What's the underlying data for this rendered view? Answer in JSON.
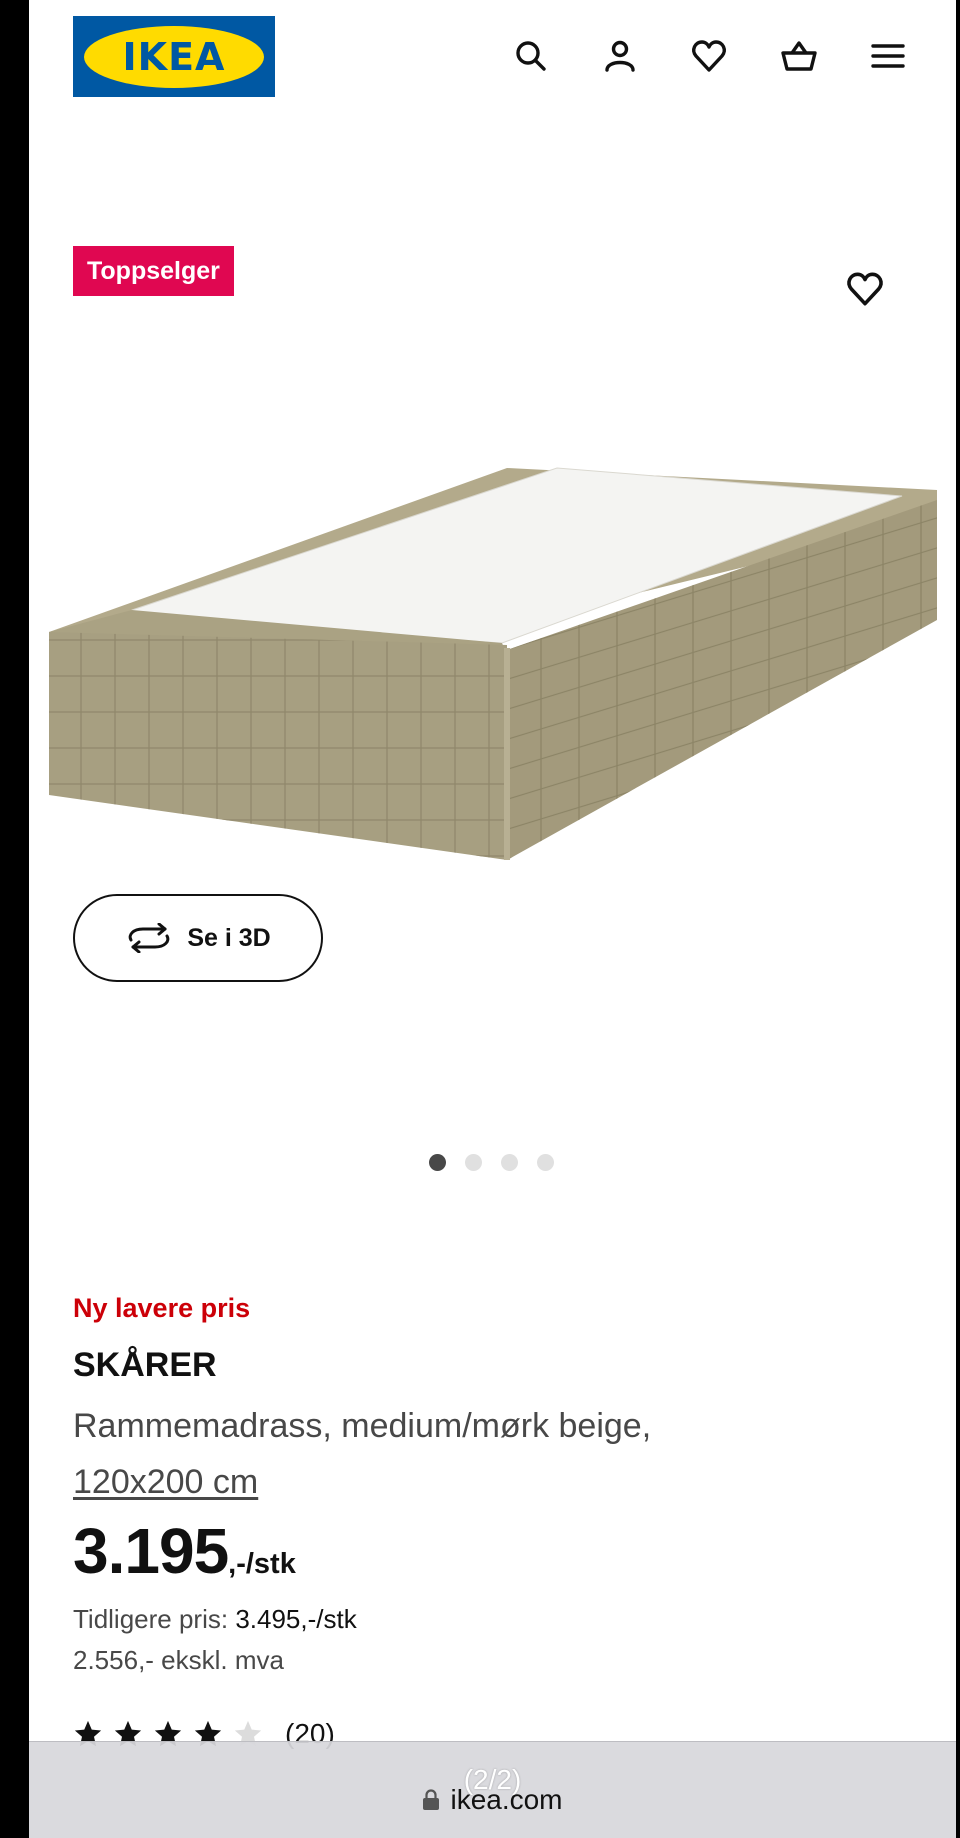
{
  "header": {
    "logo_text": "IKEA",
    "icons": [
      "search-icon",
      "account-icon",
      "heart-icon",
      "basket-icon",
      "menu-icon"
    ]
  },
  "product": {
    "badge": "Toppselger",
    "view_3d_label": "Se i 3D",
    "carousel": {
      "total": 4,
      "active_index": 1
    },
    "price_tag": "Ny lavere pris",
    "name": "SKÅRER",
    "description": "Rammemadrass, medium/mørk beige,",
    "size": "120x200 cm",
    "price_main": "3.195",
    "price_unit": ",-/stk",
    "previous_price_label": "Tidligere pris: ",
    "previous_price_value": "3.495,-/stk",
    "excl_vat": "2.556,- ekskl. mva",
    "rating": {
      "value": 4,
      "max": 5,
      "count_text": "(20)"
    }
  },
  "browser": {
    "page_indicator": "(2/2)",
    "url": "ikea.com"
  },
  "colors": {
    "ikea_blue": "#0058a3",
    "ikea_yellow": "#ffdb00",
    "badge_pink": "#e00751",
    "new_price_red": "#cc0008",
    "frame_beige": "#a39a7c"
  }
}
